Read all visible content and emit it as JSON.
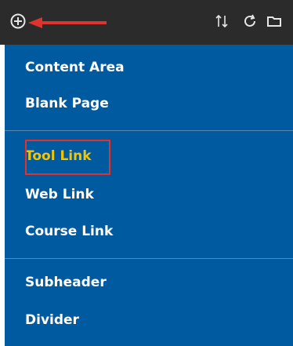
{
  "toolbar": {
    "icons": {
      "add": "plus-circle-icon",
      "sort": "sort-arrows-icon",
      "refresh": "refresh-icon",
      "folder": "folder-icon"
    },
    "colors": {
      "background": "#2b2b2b",
      "icon": "#e6e6e6",
      "arrow": "#e0332b"
    }
  },
  "menu": {
    "colors": {
      "background": "#005aa0",
      "text": "#ffffff",
      "highlight": "#f5c400",
      "callout": "#e0332b"
    },
    "groups": [
      {
        "items": [
          "Content Area",
          "Blank Page"
        ]
      },
      {
        "items": [
          "Tool Link",
          "Web Link",
          "Course Link"
        ]
      },
      {
        "items": [
          "Subheader",
          "Divider"
        ]
      }
    ],
    "highlighted_item": "Tool Link"
  }
}
